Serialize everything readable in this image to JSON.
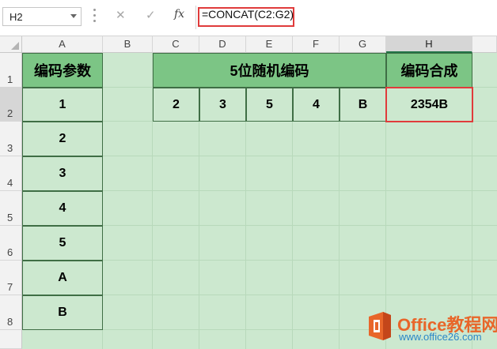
{
  "formula_bar": {
    "name_box": "H2",
    "cancel_glyph": "✕",
    "enter_glyph": "✓",
    "fx_label": "fx",
    "formula": "=CONCAT(C2:G2)"
  },
  "columns": [
    "A",
    "B",
    "C",
    "D",
    "E",
    "F",
    "G",
    "H"
  ],
  "rows": [
    "1",
    "2",
    "3",
    "4",
    "5",
    "6",
    "7",
    "8"
  ],
  "selected_cell": "H2",
  "cells": {
    "A1": "编码参数",
    "A2": "1",
    "A3": "2",
    "A4": "3",
    "A5": "4",
    "A6": "5",
    "A7": "A",
    "A8": "B",
    "C1": "5位随机编码",
    "C2": "2",
    "D2": "3",
    "E2": "5",
    "F2": "4",
    "G2": "B",
    "H1": "编码合成",
    "H2": "2354B"
  },
  "watermark": {
    "title": "Office教程网",
    "url": "www.office26.com",
    "logo_icon": "office-logo-icon"
  },
  "colors": {
    "sheet_background": "#cce8cf",
    "header_fill": "#7cc585",
    "highlight_border": "#e03b3b",
    "watermark_orange": "#e8662a"
  }
}
